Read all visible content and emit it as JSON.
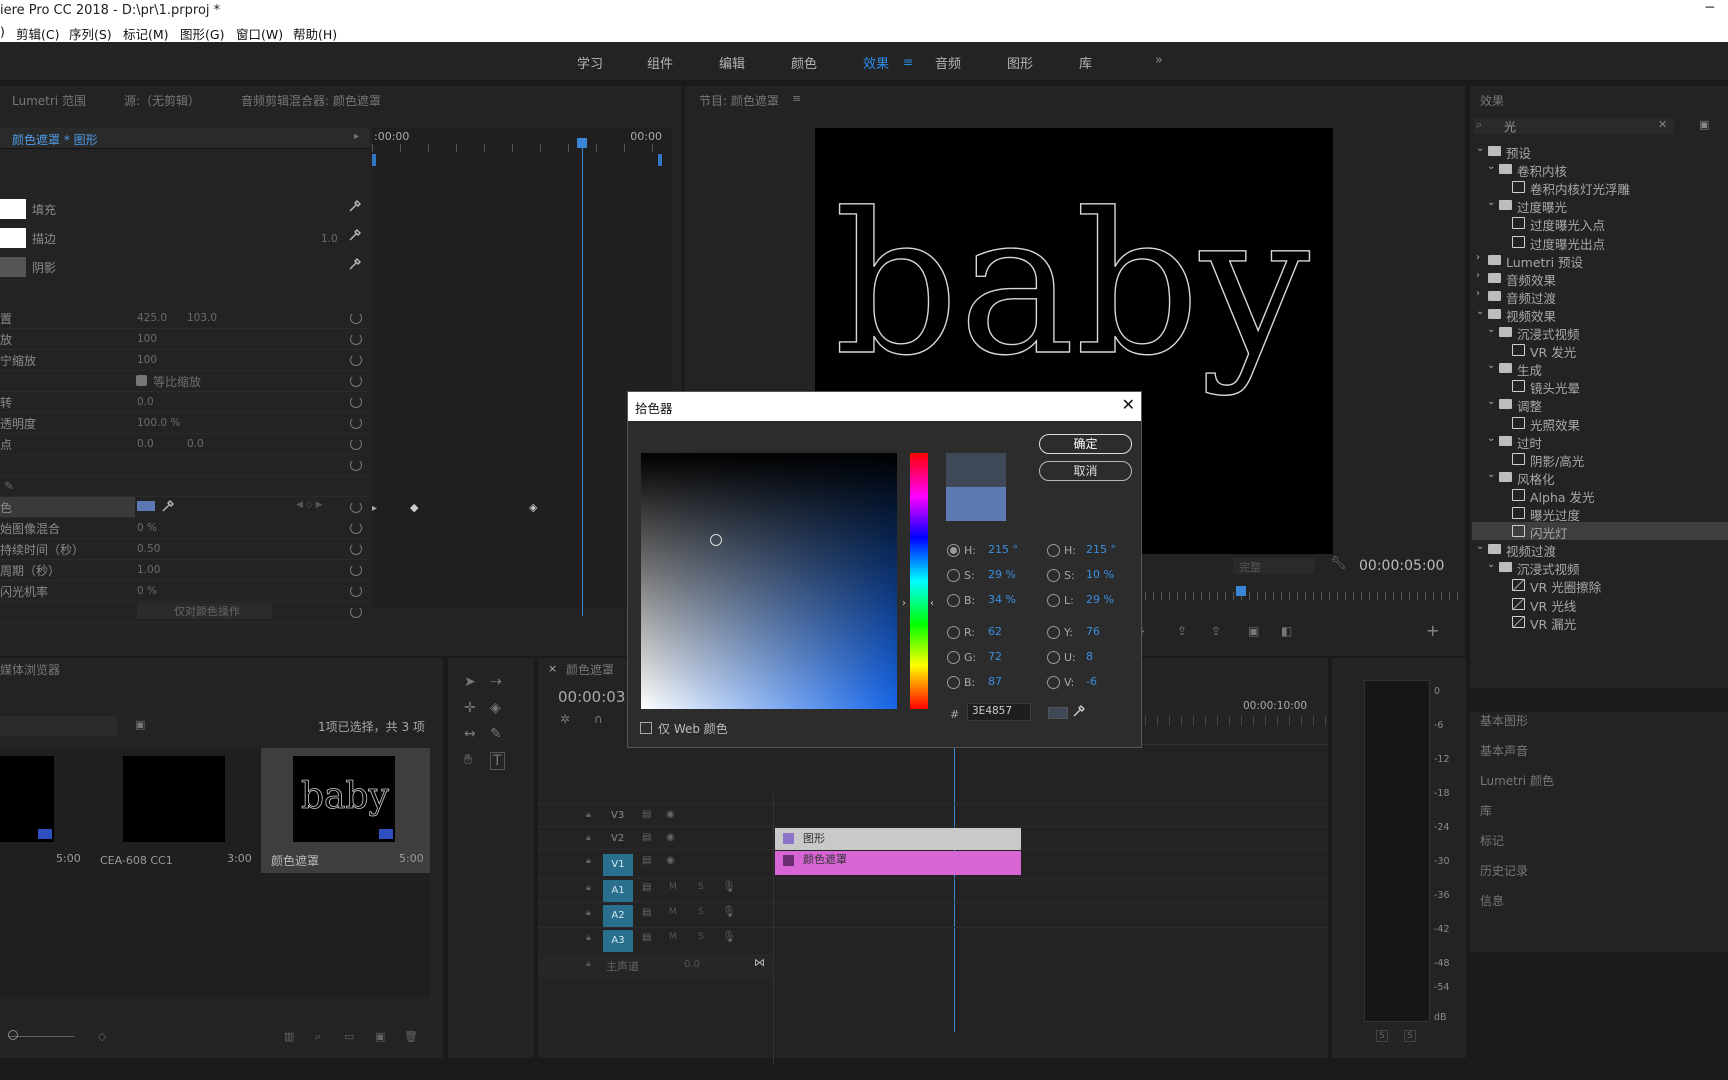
{
  "app": {
    "title": "iere Pro CC 2018 - D:\\pr\\1.prproj *",
    "minimize": "─"
  },
  "menu": [
    ")",
    "剪辑(C)",
    "序列(S)",
    "标记(M)",
    "图形(G)",
    "窗口(W)",
    "帮助(H)"
  ],
  "workspaces": [
    "学习",
    "组件",
    "编辑",
    "颜色",
    "效果",
    "音频",
    "图形",
    "库"
  ],
  "workspace_more": "»",
  "panels_top": {
    "lumetri": "Lumetri 范围",
    "source": "源:（无剪辑）",
    "audio_mixer": "音频剪辑混合器: 颜色遮罩"
  },
  "effect_controls": {
    "clip_path": "颜色遮罩 * 图形",
    "time_start": ":00:00",
    "time_end": "00:00",
    "appearance": [
      {
        "label": "填充"
      },
      {
        "label": "描边",
        "value": "1.0"
      },
      {
        "label": "阴影"
      }
    ],
    "props": [
      {
        "label": "置",
        "v1": "425.0",
        "v2": "103.0"
      },
      {
        "label": "放",
        "v1": "100"
      },
      {
        "label": "宁缩放",
        "v1": "100"
      },
      {
        "label": "",
        "v1": "等比缩放"
      },
      {
        "label": "转",
        "v1": "0.0"
      },
      {
        "label": "透明度",
        "v1": "100.0 %"
      },
      {
        "label": "点",
        "v1": "0.0",
        "v2": "0.0"
      },
      {
        "label": ""
      },
      {
        "label": ""
      },
      {
        "label": "色",
        "v1": ""
      },
      {
        "label": "始图像混合",
        "v1": "0 %"
      },
      {
        "label": "持续时间（秒）",
        "v1": "0.50"
      },
      {
        "label": "周期（秒）",
        "v1": "1.00"
      },
      {
        "label": "闪光机率",
        "v1": "0 %"
      },
      {
        "label": "",
        "v1": "仅对颜色操作"
      }
    ]
  },
  "program": {
    "title": "节目: 颜色遮罩",
    "preview_text": "baby",
    "timecode": "00:00:05:00",
    "quality": "完整"
  },
  "effects": {
    "title": "效果",
    "search": "光",
    "tree": [
      {
        "label": "预设",
        "level": 0,
        "type": "folder-preset",
        "open": true
      },
      {
        "label": "卷积内核",
        "level": 1,
        "type": "folder-preset",
        "open": true
      },
      {
        "label": "卷积内核灯光浮雕",
        "level": 2,
        "type": "preset"
      },
      {
        "label": "过度曝光",
        "level": 1,
        "type": "folder-preset",
        "open": true
      },
      {
        "label": "过度曝光入点",
        "level": 2,
        "type": "preset"
      },
      {
        "label": "过度曝光出点",
        "level": 2,
        "type": "preset"
      },
      {
        "label": "Lumetri 预设",
        "level": 0,
        "type": "folder-preset",
        "open": false
      },
      {
        "label": "音频效果",
        "level": 0,
        "type": "folder",
        "open": false
      },
      {
        "label": "音频过渡",
        "level": 0,
        "type": "folder",
        "open": false
      },
      {
        "label": "视频效果",
        "level": 0,
        "type": "folder",
        "open": true
      },
      {
        "label": "沉浸式视频",
        "level": 1,
        "type": "folder",
        "open": true
      },
      {
        "label": "VR 发光",
        "level": 2,
        "type": "fx"
      },
      {
        "label": "生成",
        "level": 1,
        "type": "folder",
        "open": true
      },
      {
        "label": "镜头光晕",
        "level": 2,
        "type": "fx"
      },
      {
        "label": "调整",
        "level": 1,
        "type": "folder",
        "open": true
      },
      {
        "label": "光照效果",
        "level": 2,
        "type": "fx"
      },
      {
        "label": "过时",
        "level": 1,
        "type": "folder",
        "open": true
      },
      {
        "label": "阴影/高光",
        "level": 2,
        "type": "fx"
      },
      {
        "label": "风格化",
        "level": 1,
        "type": "folder",
        "open": true
      },
      {
        "label": "Alpha 发光",
        "level": 2,
        "type": "fx"
      },
      {
        "label": "曝光过度",
        "level": 2,
        "type": "fx"
      },
      {
        "label": "闪光灯",
        "level": 2,
        "type": "fx",
        "selected": true
      },
      {
        "label": "视频过渡",
        "level": 0,
        "type": "folder",
        "open": true
      },
      {
        "label": "沉浸式视频",
        "level": 1,
        "type": "folder",
        "open": true
      },
      {
        "label": "VR 光圈擦除",
        "level": 2,
        "type": "tr"
      },
      {
        "label": "VR 光线",
        "level": 2,
        "type": "tr"
      },
      {
        "label": "VR 漏光",
        "level": 2,
        "type": "tr"
      }
    ],
    "collapsed_panels": [
      "基本图形",
      "基本声音",
      "Lumetri 颜色",
      "库",
      "标记",
      "历史记录",
      "信息"
    ]
  },
  "project": {
    "title": "媒体浏览器",
    "selection_info": "1项已选择，共 3 项",
    "items": [
      {
        "name": "",
        "duration": "5:00"
      },
      {
        "name": "CEA-608 CC1",
        "duration": "3:00"
      },
      {
        "name": "颜色遮罩",
        "duration": "5:00",
        "thumb": "baby"
      }
    ]
  },
  "timeline": {
    "title": "颜色遮罩",
    "timecode": "00:00:03",
    "ruler_label": "00:00:10:00",
    "video_tracks": [
      "V3",
      "V2",
      "V1"
    ],
    "audio_tracks": [
      "A1",
      "A2",
      "A3"
    ],
    "master": "主声道",
    "master_val": "0.0",
    "clips": [
      {
        "label": "图形",
        "track": "V2"
      },
      {
        "label": "颜色遮罩",
        "track": "V1"
      }
    ]
  },
  "meter": {
    "scale": [
      "0",
      "-6",
      "-12",
      "-18",
      "-24",
      "-30",
      "-36",
      "-42",
      "-48",
      "-54",
      "dB"
    ],
    "solo": "S"
  },
  "color_picker": {
    "title": "拾色器",
    "ok": "确定",
    "cancel": "取消",
    "H": {
      "label": "H:",
      "value": "215 °"
    },
    "S": {
      "label": "S:",
      "value": "29 %"
    },
    "B": {
      "label": "B:",
      "value": "34 %"
    },
    "H2": {
      "label": "H:",
      "value": "215 °"
    },
    "S2": {
      "label": "S:",
      "value": "10 %"
    },
    "L": {
      "label": "L:",
      "value": "29 %"
    },
    "R": {
      "label": "R:",
      "value": "62"
    },
    "G": {
      "label": "G:",
      "value": "72"
    },
    "Bv": {
      "label": "B:",
      "value": "87"
    },
    "Y": {
      "label": "Y:",
      "value": "76"
    },
    "U": {
      "label": "U:",
      "value": "8"
    },
    "V": {
      "label": "V:",
      "value": "-6"
    },
    "hash": "#",
    "hex": "3E4857",
    "web_only": "仅 Web 颜色",
    "new_color": "#3e4857",
    "old_color": "#5b7ab3"
  }
}
